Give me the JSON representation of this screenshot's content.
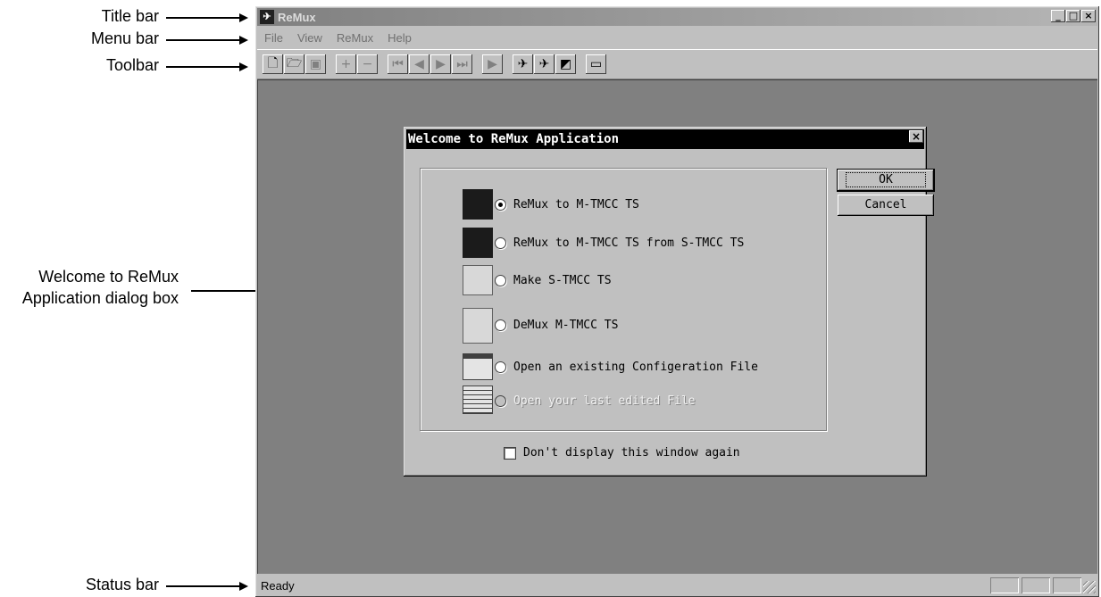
{
  "callouts": {
    "title_bar": "Title bar",
    "menu_bar": "Menu bar",
    "toolbar": "Toolbar",
    "dialog_line1": "Welcome to ReMux",
    "dialog_line2": "Application dialog box",
    "status_bar": "Status bar"
  },
  "window": {
    "title": "ReMux",
    "controls": [
      "_",
      "□",
      "×"
    ]
  },
  "menu": [
    "File",
    "View",
    "ReMux",
    "Help"
  ],
  "toolbar": {
    "buttons": [
      "new-icon",
      "open-icon",
      "save-icon",
      "add-icon",
      "remove-icon",
      "first-icon",
      "prev-icon",
      "next-icon",
      "last-icon",
      "play-icon",
      "remux-icon",
      "remux-stmcc-icon",
      "make-stmcc-icon",
      "demux-icon"
    ]
  },
  "dialog": {
    "title": "Welcome to ReMux Application",
    "options": [
      {
        "label": "ReMux to M-TMCC TS",
        "selected": true,
        "enabled": true,
        "icon": "remux-icon"
      },
      {
        "label": "ReMux to M-TMCC TS from S-TMCC TS",
        "selected": false,
        "enabled": true,
        "icon": "remux-from-stmcc-icon"
      },
      {
        "label": "Make S-TMCC TS",
        "selected": false,
        "enabled": true,
        "icon": "make-stmcc-icon"
      },
      {
        "label": "DeMux M-TMCC TS",
        "selected": false,
        "enabled": true,
        "icon": "demux-icon"
      },
      {
        "label": "Open an existing Configeration File",
        "selected": false,
        "enabled": true,
        "icon": "folder-icon"
      },
      {
        "label": "Open your last edited File",
        "selected": false,
        "enabled": false,
        "icon": "recent-file-icon"
      }
    ],
    "ok_label": "OK",
    "cancel_label": "Cancel",
    "checkbox_label": "Don't display this window again"
  },
  "status": {
    "text": "Ready"
  }
}
